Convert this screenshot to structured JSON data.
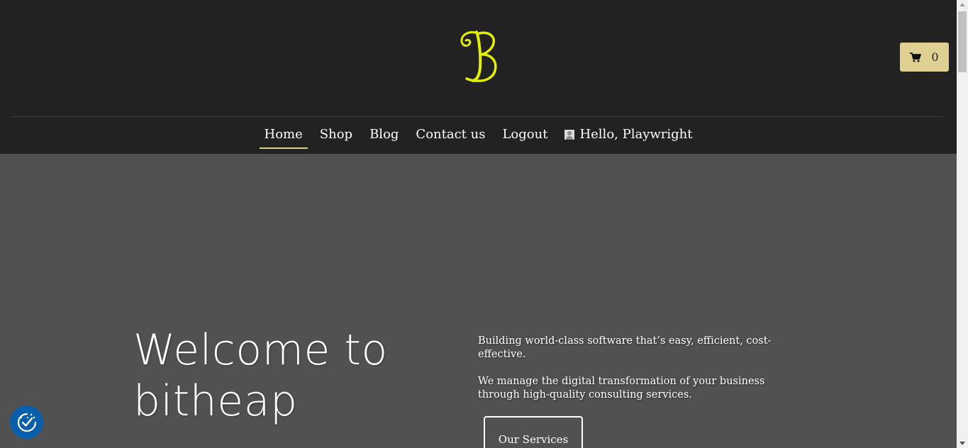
{
  "header": {
    "logo_letter": "B",
    "cart_count": "0"
  },
  "nav": {
    "items": [
      {
        "label": "Home",
        "active": true
      },
      {
        "label": "Shop"
      },
      {
        "label": "Blog"
      },
      {
        "label": "Contact us"
      },
      {
        "label": "Logout"
      }
    ],
    "user_greeting": "Hello, Playwright"
  },
  "hero": {
    "title": "Welcome to bitheap",
    "text_1": "Building world-class software that’s easy, efficient, cost-effective.",
    "text_2": "We manage the digital transformation of your business through high-quality consulting services.",
    "button_label": "Our Services"
  },
  "colors": {
    "header_bg": "#222222",
    "hero_bg": "#515151",
    "accent": "#e0d193",
    "logo": "#e5f000",
    "consent_bg": "#0a5fad"
  },
  "icons": {
    "cart": "shopping-cart-icon",
    "consent": "cookie-consent-icon",
    "avatar": "user-avatar-icon"
  }
}
